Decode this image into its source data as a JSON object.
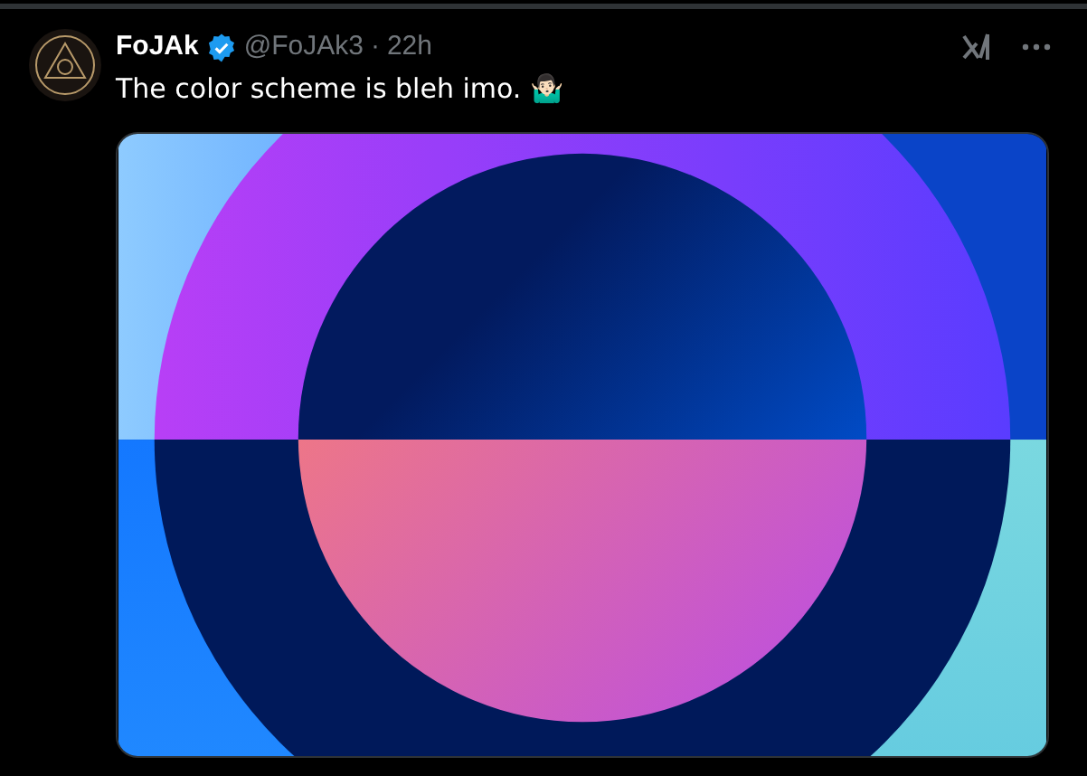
{
  "post": {
    "author": "FoJAk",
    "verified": true,
    "handle": "@FoJAk3",
    "separator": "·",
    "time": "22h",
    "text": "The color scheme is bleh imo. 🤷🏻‍♂️"
  }
}
